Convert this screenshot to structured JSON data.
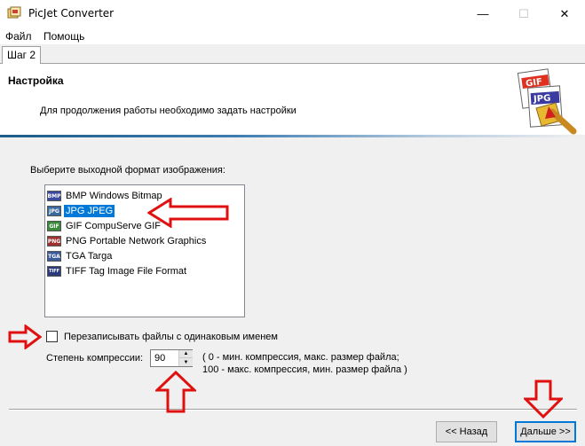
{
  "window": {
    "title": "PicJet Converter",
    "minimize_glyph": "—",
    "maximize_glyph": "☐",
    "close_glyph": "✕"
  },
  "menu": [
    "Файл",
    "Помощь"
  ],
  "tabs": [
    {
      "label": "Шаг 2",
      "active": true
    }
  ],
  "header": {
    "title": "Настройка",
    "description": "Для продолжения работы необходимо задать настройки"
  },
  "format_section": {
    "label": "Выберите выходной формат изображения:",
    "options": [
      {
        "icon_text": "BMP",
        "label": "BMP Windows Bitmap",
        "icon_color": "#3a4aa0",
        "selected": false
      },
      {
        "icon_text": "JPG",
        "label": "JPG JPEG",
        "icon_color": "#3a6aa0",
        "selected": true
      },
      {
        "icon_text": "GIF",
        "label": "GIF CompuServe GIF",
        "icon_color": "#3a8a3a",
        "selected": false
      },
      {
        "icon_text": "PNG",
        "label": "PNG Portable Network Graphics",
        "icon_color": "#a03030",
        "selected": false
      },
      {
        "icon_text": "TGA",
        "label": "TGA Targa",
        "icon_color": "#3a5a9a",
        "selected": false
      },
      {
        "icon_text": "TIFF",
        "label": "TIFF Tag Image File Format",
        "icon_color": "#2a3a7a",
        "selected": false
      }
    ]
  },
  "overwrite": {
    "label": "Перезаписывать файлы с одинаковым именем",
    "checked": false
  },
  "compression": {
    "label": "Степень компрессии:",
    "value": "90",
    "hint_line1": "( 0 - мин. компрессия, макс. размер файла;",
    "hint_line2": "100 - макс. компрессия, мин. размер файла )"
  },
  "buttons": {
    "back": "<< Назад",
    "next": "Дальше >>"
  },
  "colors": {
    "annotation_arrow": "#e01010",
    "selection": "#0078d7",
    "header_accent": "#1d5c88"
  },
  "icons": [
    "app-icon",
    "picjet-logo",
    "bmp-icon",
    "jpg-icon",
    "gif-icon",
    "png-icon",
    "tga-icon",
    "tiff-icon",
    "spin-up-icon",
    "spin-down-icon"
  ]
}
